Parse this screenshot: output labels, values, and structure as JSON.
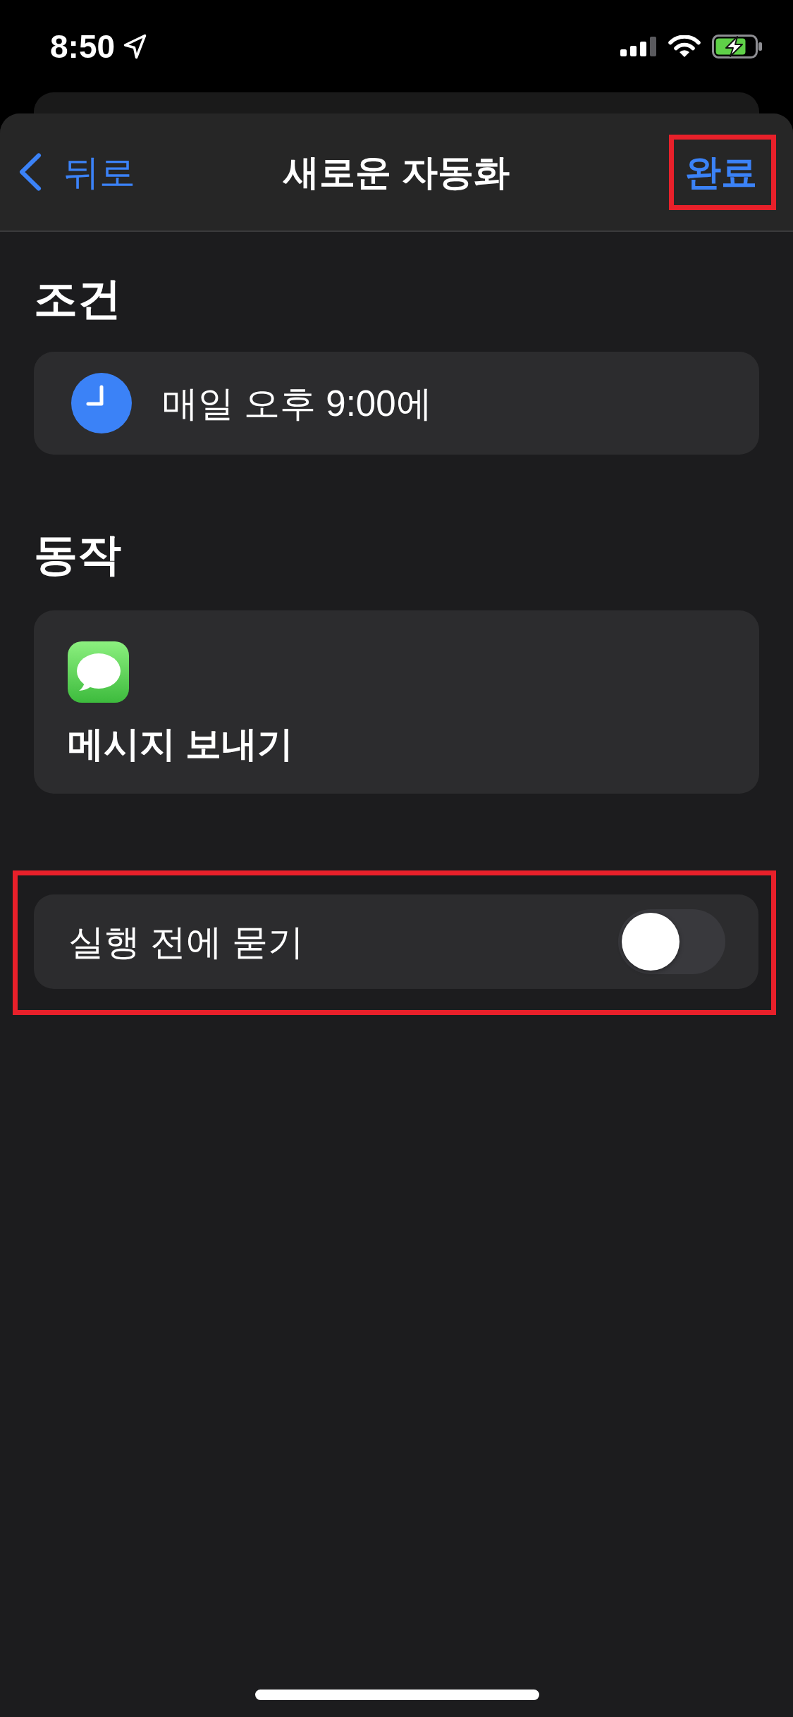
{
  "status_bar": {
    "time": "8:50"
  },
  "nav_bar": {
    "back_label": "뒤로",
    "title": "새로운 자동화",
    "done": {
      "label": "완료",
      "highlighted": true
    }
  },
  "sections": [
    {
      "kind": "trigger",
      "heading": "조건",
      "text": "매일 오후 9:00에"
    },
    {
      "kind": "action",
      "heading": "동작",
      "text": "메시지 보내기"
    }
  ],
  "ask_before_running": {
    "label": "실행 전에 묻기",
    "on": false,
    "highlighted": true
  }
}
